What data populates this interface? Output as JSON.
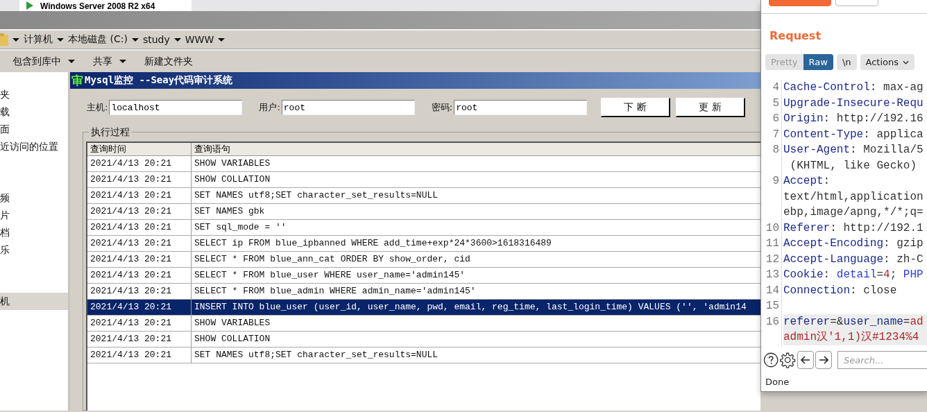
{
  "vm_tab": {
    "title": "Windows Server 2008 R2 x64"
  },
  "breadcrumb": [
    "计算机",
    "本地磁盘 (C:)",
    "study",
    "WWW"
  ],
  "toolbar": [
    {
      "label": "包含到库中",
      "dropdown": true
    },
    {
      "label": "共享",
      "dropdown": true
    },
    {
      "label": "新建文件夹",
      "dropdown": false
    }
  ],
  "nav": {
    "groups": [
      [
        {
          "label": "夹",
          "selected": false
        },
        {
          "label": "载",
          "selected": false
        },
        {
          "label": "面",
          "selected": false
        },
        {
          "label": "近访问的位置",
          "selected": false
        }
      ],
      [
        {
          "label": "频",
          "selected": false
        },
        {
          "label": "片",
          "selected": false
        },
        {
          "label": "档",
          "selected": false
        },
        {
          "label": "乐",
          "selected": false
        }
      ],
      [
        {
          "label": "机",
          "selected": true
        }
      ]
    ]
  },
  "monitor": {
    "icon_text": "审",
    "title": "Mysql监控 --Seay代码审计系统",
    "fields": [
      {
        "label": "主机:",
        "value": "localhost"
      },
      {
        "label": "用户:",
        "value": "root"
      },
      {
        "label": "密码:",
        "value": "root"
      }
    ],
    "buttons": [
      "下 断",
      "更 新"
    ],
    "group_title": "执行过程",
    "table": {
      "columns": [
        "查询时间",
        "查询语句"
      ],
      "rows": [
        {
          "time": "2021/4/13 20:21",
          "query": "SHOW VARIABLES",
          "selected": false
        },
        {
          "time": "2021/4/13 20:21",
          "query": "SHOW COLLATION",
          "selected": false
        },
        {
          "time": "2021/4/13 20:21",
          "query": "SET NAMES utf8;SET character_set_results=NULL",
          "selected": false
        },
        {
          "time": "2021/4/13 20:21",
          "query": "SET NAMES gbk",
          "selected": false
        },
        {
          "time": "2021/4/13 20:21",
          "query": "SET sql_mode = ''",
          "selected": false
        },
        {
          "time": "2021/4/13 20:21",
          "query": "SELECT ip FROM blue_ipbanned WHERE add_time+exp*24*3600>1618316489",
          "selected": false
        },
        {
          "time": "2021/4/13 20:21",
          "query": "SELECT * FROM blue_ann_cat ORDER BY show_order, cid",
          "selected": false
        },
        {
          "time": "2021/4/13 20:21",
          "query": "SELECT * FROM blue_user WHERE user_name='admin145'",
          "selected": false
        },
        {
          "time": "2021/4/13 20:21",
          "query": "SELECT * FROM blue_admin WHERE admin_name='admin145'",
          "selected": false
        },
        {
          "time": "2021/4/13 20:21",
          "query": "INSERT INTO blue_user (user_id, user_name, pwd, email, reg_time, last_login_time) VALUES ('', 'admin14",
          "selected": true
        },
        {
          "time": "2021/4/13 20:21",
          "query": "SHOW VARIABLES",
          "selected": false
        },
        {
          "time": "2021/4/13 20:21",
          "query": "SHOW COLLATION",
          "selected": false
        },
        {
          "time": "2021/4/13 20:21",
          "query": "SET NAMES utf8;SET character_set_results=NULL",
          "selected": false
        }
      ]
    }
  },
  "request_panel": {
    "title": "Request",
    "tabs": [
      {
        "label": "Pretty",
        "selected": false
      },
      {
        "label": "Raw",
        "selected": true
      },
      {
        "label": "\\n",
        "selected": false
      },
      {
        "label": "Actions",
        "selected": false
      }
    ],
    "lines": [
      {
        "number": "4",
        "current": false,
        "rows": [
          [
            {
              "kind": "name",
              "text": "Cache-Control"
            },
            {
              "kind": "plain",
              "text": ": max-ag"
            }
          ]
        ]
      },
      {
        "number": "5",
        "current": false,
        "rows": [
          [
            {
              "kind": "name",
              "text": "Upgrade-Insecure-Requ"
            }
          ]
        ]
      },
      {
        "number": "6",
        "current": false,
        "rows": [
          [
            {
              "kind": "name",
              "text": "Origin"
            },
            {
              "kind": "plain",
              "text": ": http://192.16"
            }
          ]
        ]
      },
      {
        "number": "7",
        "current": false,
        "rows": [
          [
            {
              "kind": "name",
              "text": "Content-Type"
            },
            {
              "kind": "plain",
              "text": ": applica"
            }
          ]
        ]
      },
      {
        "number": "8",
        "current": false,
        "rows": [
          [
            {
              "kind": "name",
              "text": "User-Agent"
            },
            {
              "kind": "plain",
              "text": ": Mozilla/5"
            }
          ],
          [
            {
              "kind": "plain",
              "text": " (KHTML, like Gecko)"
            }
          ]
        ]
      },
      {
        "number": "9",
        "current": false,
        "rows": [
          [
            {
              "kind": "name",
              "text": "Accept"
            },
            {
              "kind": "plain",
              "text": ":"
            }
          ],
          [
            {
              "kind": "plain",
              "text": "text/html,application"
            }
          ],
          [
            {
              "kind": "plain",
              "text": "ebp,image/apng,*/*;q="
            }
          ]
        ]
      },
      {
        "number": "10",
        "current": false,
        "rows": [
          [
            {
              "kind": "name",
              "text": "Referer"
            },
            {
              "kind": "plain",
              "text": ": http://192.1"
            }
          ]
        ]
      },
      {
        "number": "11",
        "current": false,
        "rows": [
          [
            {
              "kind": "name",
              "text": "Accept-Encoding"
            },
            {
              "kind": "plain",
              "text": ": gzip"
            }
          ]
        ]
      },
      {
        "number": "12",
        "current": false,
        "rows": [
          [
            {
              "kind": "name",
              "text": "Accept-Language"
            },
            {
              "kind": "plain",
              "text": ": zh-C"
            }
          ]
        ]
      },
      {
        "number": "13",
        "current": false,
        "rows": [
          [
            {
              "kind": "name",
              "text": "Cookie"
            },
            {
              "kind": "plain",
              "text": ": "
            },
            {
              "kind": "param",
              "text": "detail"
            },
            {
              "kind": "plain",
              "text": "="
            },
            {
              "kind": "value",
              "text": "4"
            },
            {
              "kind": "plain",
              "text": "; "
            },
            {
              "kind": "param",
              "text": "PHP"
            }
          ]
        ]
      },
      {
        "number": "14",
        "current": false,
        "rows": [
          [
            {
              "kind": "name",
              "text": "Connection"
            },
            {
              "kind": "plain",
              "text": ": close"
            }
          ]
        ]
      },
      {
        "number": "15",
        "current": false
      },
      {
        "number": "16",
        "current": true,
        "rows": [
          [
            {
              "kind": "name",
              "text": "referer"
            },
            {
              "kind": "plain",
              "text": "=&"
            },
            {
              "kind": "name",
              "text": "user_name"
            },
            {
              "kind": "plain",
              "text": "="
            },
            {
              "kind": "value",
              "text": "ad"
            }
          ],
          [
            {
              "kind": "value",
              "text": "admin汉'1,1)汉#1234%4"
            }
          ]
        ]
      }
    ],
    "search": {
      "placeholder": "Search..."
    },
    "status": "Done"
  }
}
